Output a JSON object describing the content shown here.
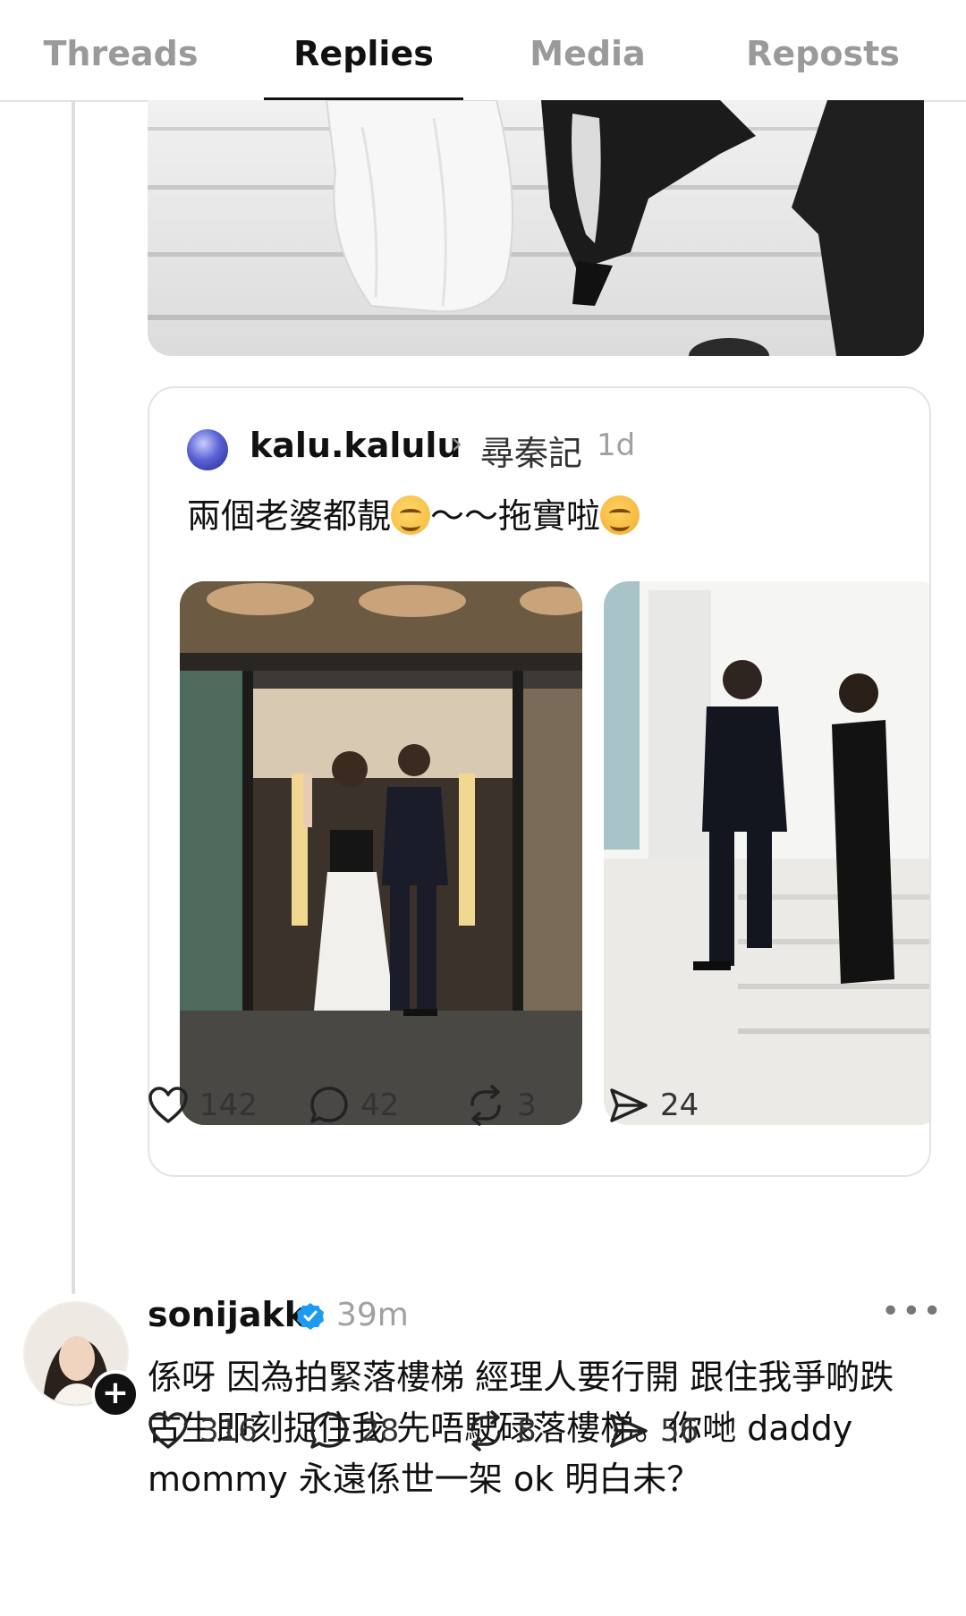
{
  "tabs": [
    {
      "label": "Threads"
    },
    {
      "label": "Replies"
    },
    {
      "label": "Media"
    },
    {
      "label": "Reposts"
    }
  ],
  "active_tab": "Replies",
  "quote": {
    "username": "kalu.kalulu",
    "topic": "尋秦記",
    "time": "1d",
    "text_part1": "兩個老婆都靚",
    "text_part2": "～～拖實啦",
    "emoji_1": "smiling-face",
    "emoji_2": "relieved-face"
  },
  "post_actions": {
    "likes": "142",
    "comments": "42",
    "reposts": "3",
    "shares": "24"
  },
  "reply": {
    "username": "sonijakk",
    "verified": true,
    "time": "39m",
    "more": "•••",
    "text": "係呀 因為拍緊落樓梯 經理人要行開 跟住我爭啲跌 古生即刻捉住我 先唔駛碌落樓梯。你哋 daddy mommy 永遠係世一架 ok 明白未？",
    "follow": "+",
    "likes": "316",
    "comments": "28",
    "reposts": "8",
    "shares": "56"
  },
  "colors": {
    "text": "#111111",
    "muted": "#9a9a9a",
    "divider": "#e2e2e2",
    "verified": "#1d9bf0"
  }
}
